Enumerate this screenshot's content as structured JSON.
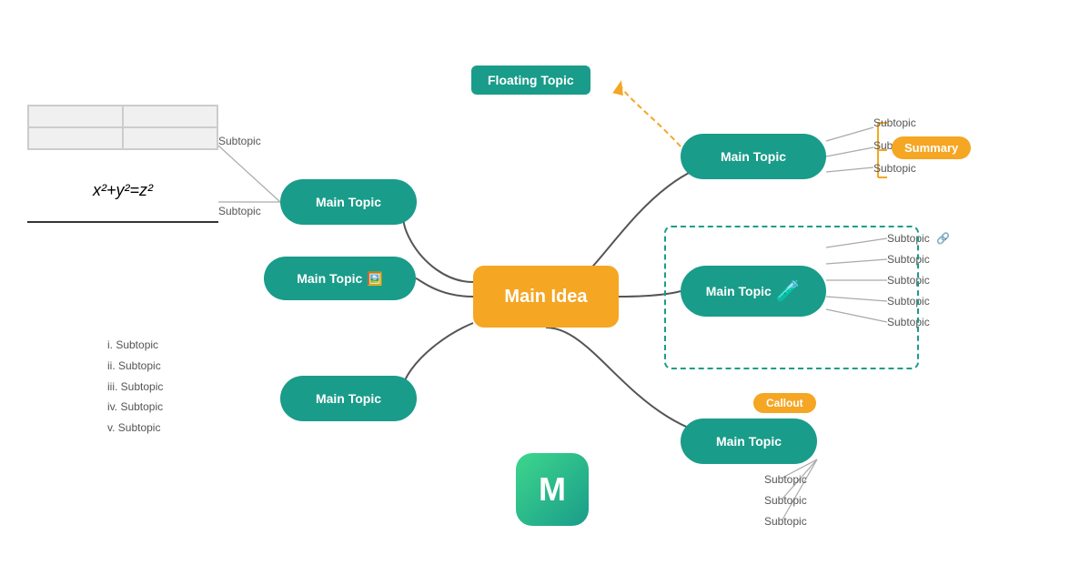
{
  "mainIdea": {
    "label": "Main Idea"
  },
  "floatingTopic": {
    "label": "Floating Topic"
  },
  "mainTopics": {
    "topRight": "Main Topic",
    "midRight": "Main Topic",
    "botRight": "Main Topic",
    "leftTop": "Main Topic",
    "leftMid": "Main Topic",
    "leftBot": "Main Topic"
  },
  "summary": {
    "label": "Summary"
  },
  "callout": {
    "label": "Callout"
  },
  "subtopics": {
    "topRightList": [
      "Subtopic",
      "Subtopic",
      "Subtopic"
    ],
    "midRightList": [
      "Subtopic",
      "Subtopic",
      "Subtopic",
      "Subtopic",
      "Subtopic"
    ],
    "botRightList": [
      "Subtopic",
      "Subtopic",
      "Subtopic"
    ],
    "leftTableSubtopic": "Subtopic",
    "leftEqSubtopic": "Subtopic",
    "leftMidSubtopic": "Main Topic",
    "leftBotList": [
      "i. Subtopic",
      "ii. Subtopic",
      "iii. Subtopic",
      "iv. Subtopic",
      "v. Subtopic"
    ]
  },
  "logo": {
    "icon": "M"
  },
  "equation": "x²+y²=z²",
  "colors": {
    "teal": "#1a9c8a",
    "orange": "#f5a623",
    "white": "#ffffff",
    "subtopicLine": "#888888",
    "dashBorder": "#1a9c8a"
  }
}
